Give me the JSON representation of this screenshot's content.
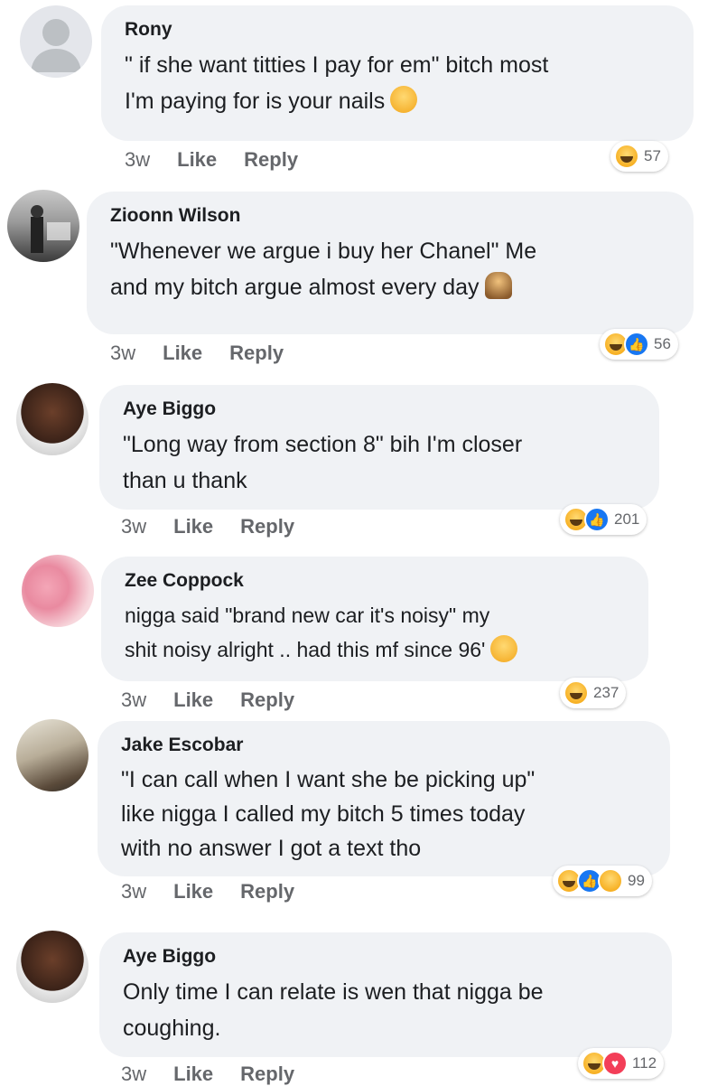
{
  "comments": [
    {
      "author": "Rony",
      "lines": [
        "\" if she want titties I pay for em\" bitch most",
        "I'm paying for is your nails"
      ],
      "time": "3w",
      "like": "Like",
      "reply": "Reply",
      "reactions": [
        "haha"
      ],
      "count": "57"
    },
    {
      "author": "Zioonn Wilson",
      "lines": [
        "\"Whenever we argue i buy her Chanel\" Me",
        "and my bitch argue almost every day"
      ],
      "time": "3w",
      "like": "Like",
      "reply": "Reply",
      "reactions": [
        "haha",
        "like"
      ],
      "count": "56"
    },
    {
      "author": "Aye Biggo",
      "lines": [
        "\"Long way from section 8\" bih I'm closer",
        "than u thank"
      ],
      "time": "3w",
      "like": "Like",
      "reply": "Reply",
      "reactions": [
        "haha",
        "like"
      ],
      "count": "201"
    },
    {
      "author": "Zee Coppock",
      "lines": [
        "nigga said \"brand new car it's noisy\" my",
        "shit noisy alright .. had this mf since 96'"
      ],
      "time": "3w",
      "like": "Like",
      "reply": "Reply",
      "reactions": [
        "haha"
      ],
      "count": "237"
    },
    {
      "author": "Jake Escobar",
      "lines": [
        "\"I can call when I want she be picking up\"",
        "like nigga I called my bitch 5 times today",
        "with no answer I got a text tho"
      ],
      "time": "3w",
      "like": "Like",
      "reply": "Reply",
      "reactions": [
        "haha",
        "like",
        "wow"
      ],
      "count": "99"
    },
    {
      "author": "Aye Biggo",
      "lines": [
        "Only time I can relate is wen that nigga be",
        "coughing."
      ],
      "time": "3w",
      "like": "Like",
      "reply": "Reply",
      "reactions": [
        "haha",
        "love"
      ],
      "count": "112"
    }
  ],
  "colors": {
    "bubble": "#f0f2f5",
    "meta": "#65676b",
    "like_icon": "#1877f2",
    "love_icon": "#f33e58",
    "haha_icon": "#f7b125"
  }
}
